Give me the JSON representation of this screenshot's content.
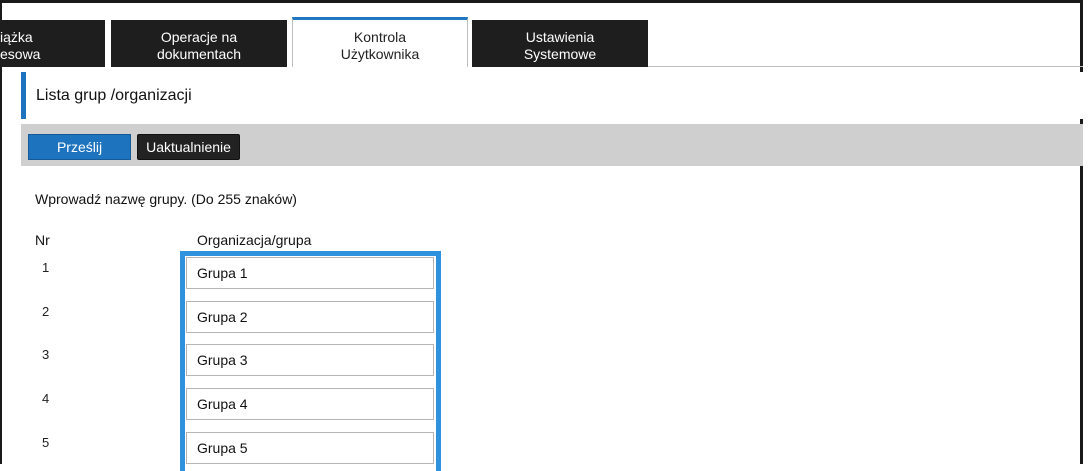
{
  "tabs": [
    {
      "label_line1": "iążka",
      "label_line2": "esowa"
    },
    {
      "label_line1": "Operacje na",
      "label_line2": "dokumentach"
    },
    {
      "label_line1": "Kontrola",
      "label_line2": "Użytkownika"
    },
    {
      "label_line1": "Ustawienia",
      "label_line2": "Systemowe"
    }
  ],
  "page": {
    "title": "Lista grup /organizacji"
  },
  "toolbar": {
    "submit_label": "Prześlij",
    "update_label": "Uaktualnienie"
  },
  "form": {
    "hint": "Wprowadź nazwę grupy. (Do 255 znaków)",
    "col_nr": "Nr",
    "col_org": "Organizacja/grupa",
    "rows": [
      {
        "nr": "1",
        "value": "Grupa 1"
      },
      {
        "nr": "2",
        "value": "Grupa 2"
      },
      {
        "nr": "3",
        "value": "Grupa 3"
      },
      {
        "nr": "4",
        "value": "Grupa 4"
      },
      {
        "nr": "5",
        "value": "Grupa 5"
      }
    ]
  },
  "colors": {
    "accent": "#1e73be",
    "focus": "#2e93dc",
    "tab_dark": "#1e1e1e",
    "toolbar_bg": "#cfcfcf"
  }
}
